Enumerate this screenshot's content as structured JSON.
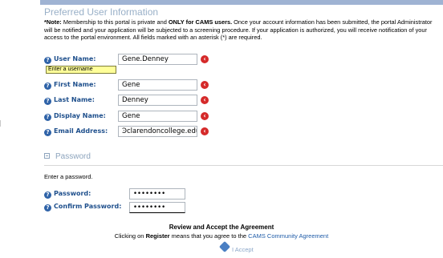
{
  "section_title": "Preferred User Information",
  "note": {
    "prefix": "*Note:",
    "text1": " Membership to this portal is private and ",
    "bold": "ONLY for CAMS users.",
    "text2": " Once your account information has been submitted, the portal Administrator will be notified and your application will be subjected to a screening procedure. If your application is authorized, you will receive notification of your access to the portal environment. All fields marked with an asterisk (*) are required."
  },
  "fields": {
    "username": {
      "label": "User Name:",
      "value": "Gene.Denney",
      "tooltip": "Enter a username"
    },
    "first_name": {
      "label": "First Name:",
      "value": "Gene"
    },
    "last_name": {
      "label": "Last Name:",
      "value": "Denney"
    },
    "display_name": {
      "label": "Display Name:",
      "value": "Gene"
    },
    "email": {
      "label": "Email Address:",
      "value": "Ͽclarendoncollege.edu"
    }
  },
  "password_section": {
    "title": "Password",
    "help": "Enter a password.",
    "password_label": "Password:",
    "password_value": "••••••••",
    "confirm_label": "Confirm Password:",
    "confirm_value": "••••••••"
  },
  "agreement": {
    "title": "Review and Accept the Agreement",
    "text_prefix": "Clicking on ",
    "register_word": "Register",
    "text_middle": " means that you agree to the ",
    "link_text": "CAMS Community Agreement",
    "accept_label": "I Accept"
  },
  "colors": {
    "label_blue": "#1e4f8c",
    "required_red": "#d52a2a",
    "tooltip_yellow": "#ffff99"
  }
}
